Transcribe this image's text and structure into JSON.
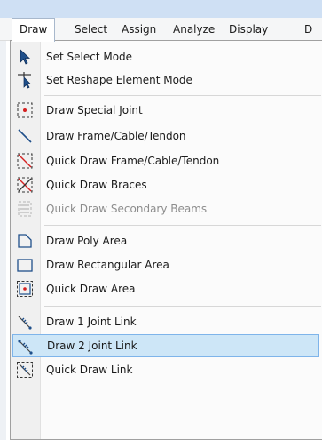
{
  "menubar": {
    "items": [
      {
        "label": "Draw"
      },
      {
        "label": "Select"
      },
      {
        "label": "Assign"
      },
      {
        "label": "Analyze"
      },
      {
        "label": "Display"
      },
      {
        "label": "D"
      }
    ]
  },
  "dropdown": {
    "items": [
      {
        "label": "Set Select Mode",
        "icon": "pointer-arrow-icon"
      },
      {
        "label": "Set Reshape Element Mode",
        "icon": "reshape-pointer-icon"
      },
      {
        "label": "Draw Special Joint",
        "icon": "special-joint-icon"
      },
      {
        "label": "Draw Frame/Cable/Tendon",
        "icon": "frame-line-icon"
      },
      {
        "label": "Quick Draw Frame/Cable/Tendon",
        "icon": "quick-frame-icon"
      },
      {
        "label": "Quick Draw Braces",
        "icon": "braces-icon"
      },
      {
        "label": "Quick Draw Secondary Beams",
        "icon": "secondary-beams-icon",
        "disabled": true
      },
      {
        "label": "Draw Poly Area",
        "icon": "poly-area-icon"
      },
      {
        "label": "Draw Rectangular Area",
        "icon": "rect-area-icon"
      },
      {
        "label": "Quick Draw Area",
        "icon": "quick-area-icon"
      },
      {
        "label": "Draw 1 Joint Link",
        "icon": "one-joint-link-icon"
      },
      {
        "label": "Draw 2 Joint Link",
        "icon": "two-joint-link-icon",
        "highlighted": true
      },
      {
        "label": "Quick Draw Link",
        "icon": "quick-link-icon"
      }
    ]
  },
  "colors": {
    "highlight_bg": "#cde6f7",
    "highlight_border": "#7eb4ea",
    "icon_blue": "#1f4f8a",
    "joint_red": "#d42020"
  }
}
